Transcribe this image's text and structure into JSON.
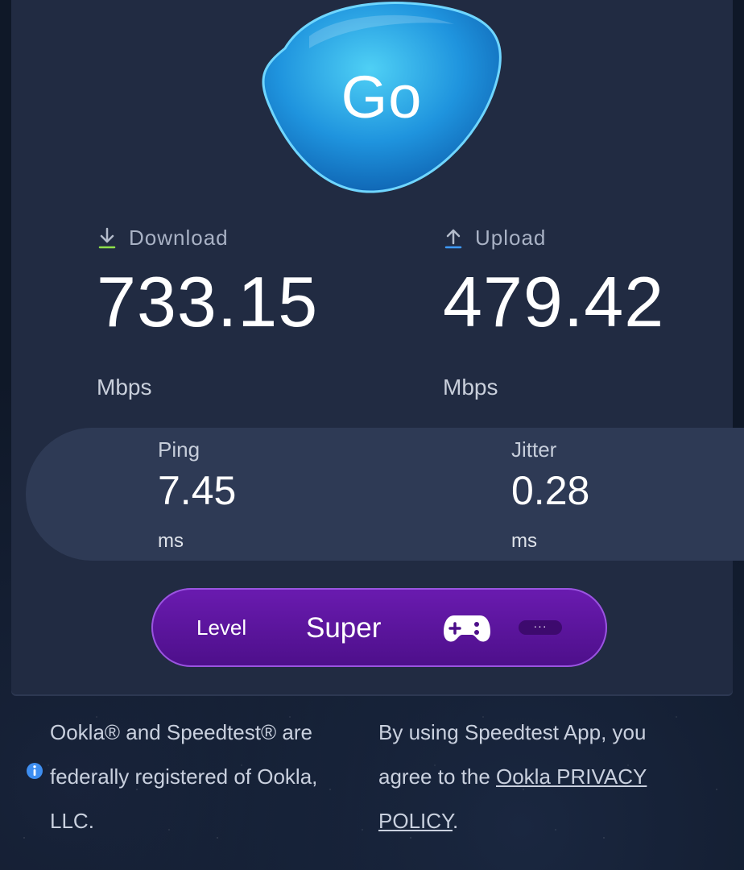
{
  "go_button": {
    "label": "Go"
  },
  "download": {
    "label": "Download",
    "value": "733.15",
    "unit": "Mbps",
    "icon": "download-arrow-icon"
  },
  "upload": {
    "label": "Upload",
    "value": "479.42",
    "unit": "Mbps",
    "icon": "upload-arrow-icon"
  },
  "ping": {
    "label": "Ping",
    "value": "7.45",
    "unit": "ms"
  },
  "jitter": {
    "label": "Jitter",
    "value": "0.28",
    "unit": "ms"
  },
  "level": {
    "label": "Level",
    "value": "Super",
    "icon": "gamepad-icon",
    "more_label": "···"
  },
  "footer": {
    "trademark_text": "Ookla® and Speedtest® are federally registered of Ookla, LLC.",
    "agreement_prefix": "By using Speedtest App, you agree to the ",
    "privacy_link": "Ookla PRIVACY POLICY",
    "agreement_suffix": ".",
    "info_icon": "info-icon"
  },
  "colors": {
    "panel": "#212b42",
    "latency_card": "#2e3a55",
    "go_button": "#2aa6e6",
    "level_pill": "#5a14a0",
    "download_accent": "#8ee04a",
    "upload_accent": "#3f9bff"
  }
}
